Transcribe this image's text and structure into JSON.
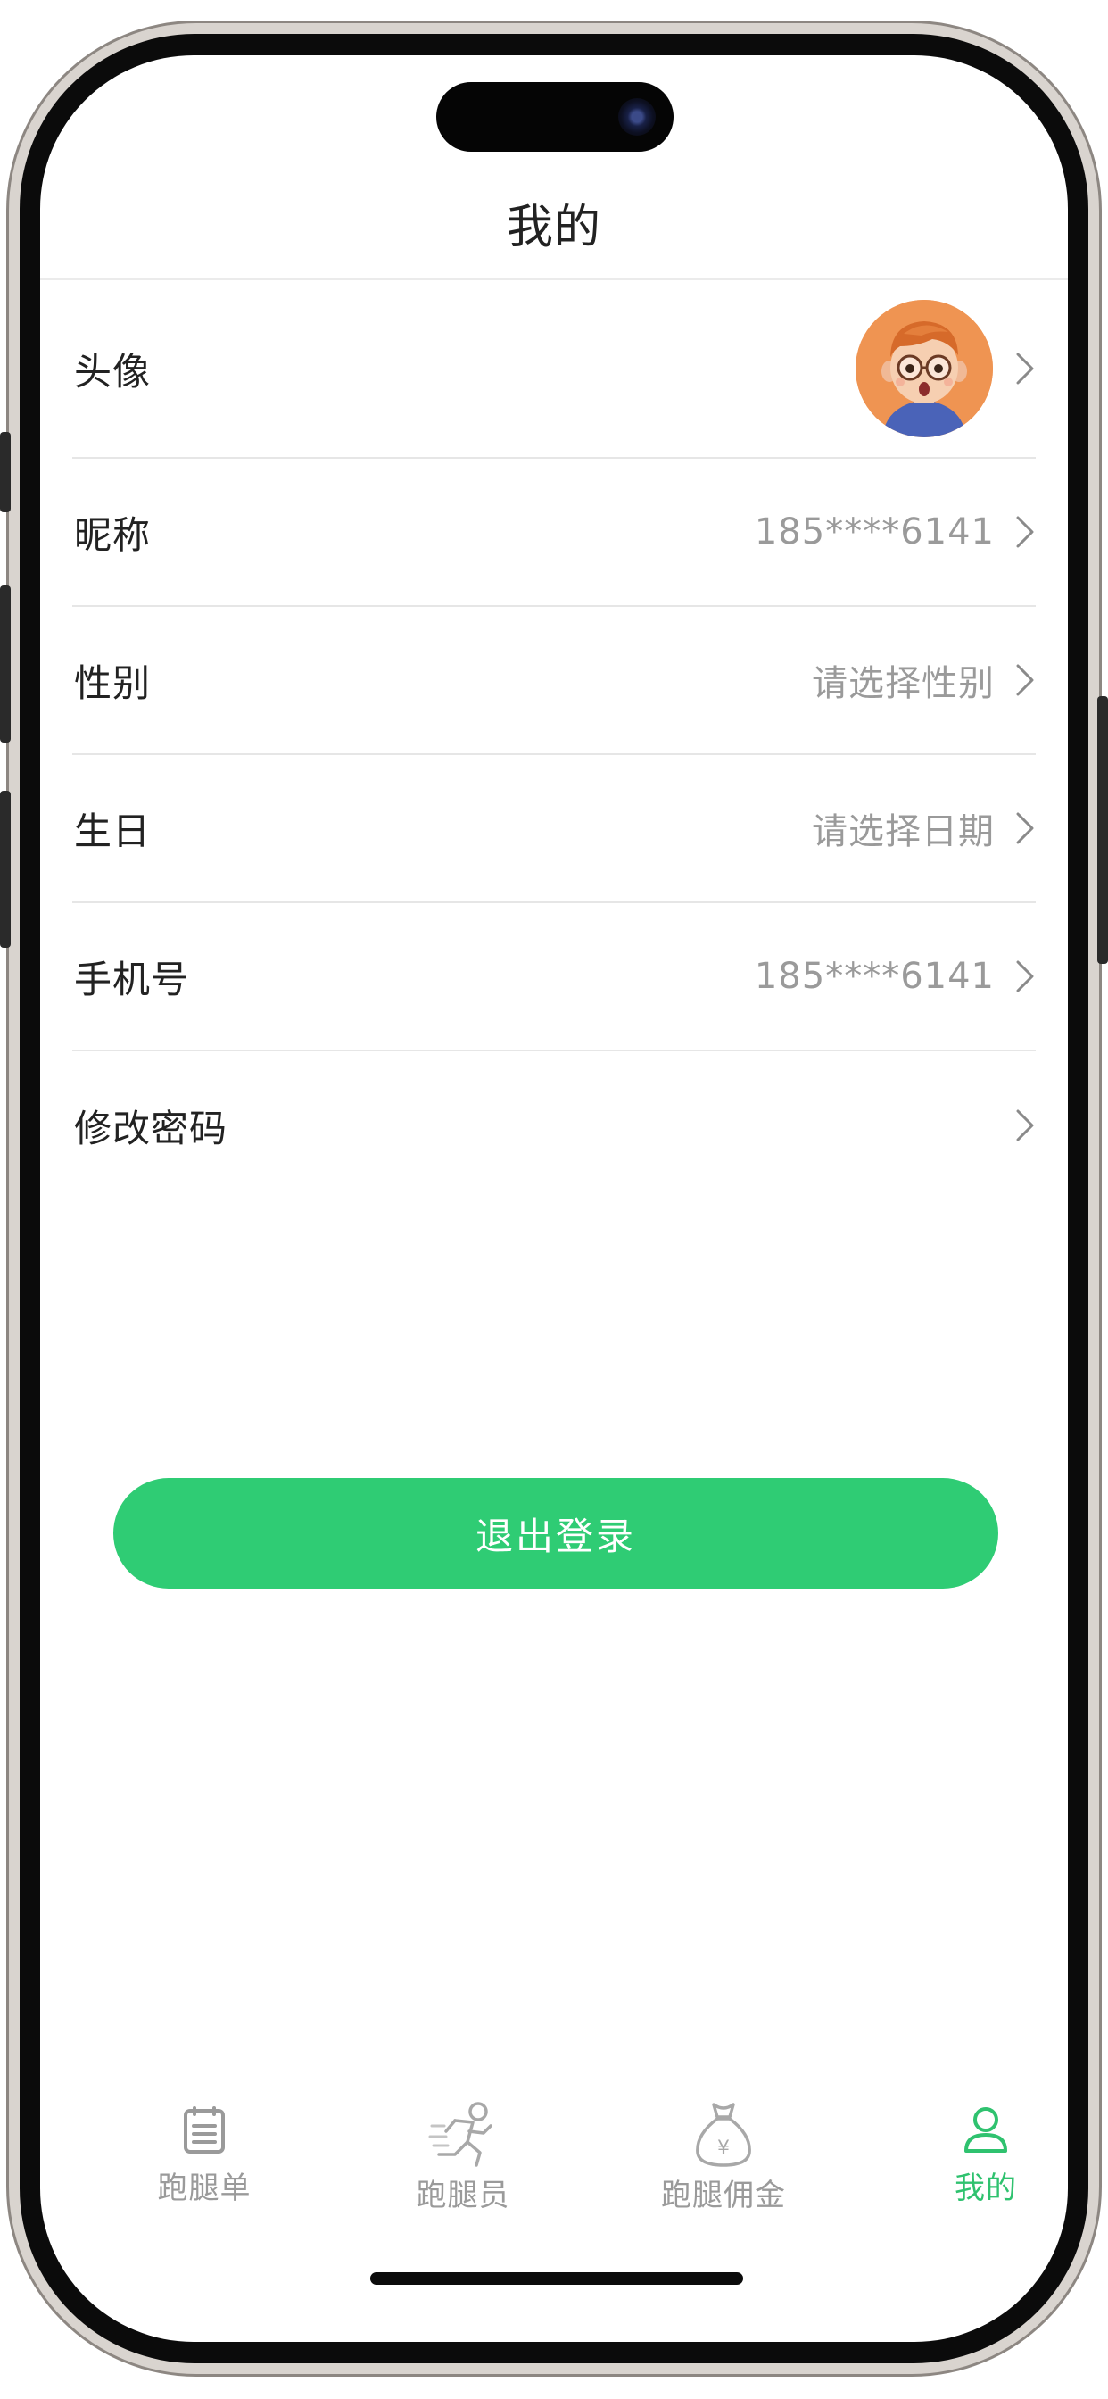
{
  "header": {
    "title": "我的"
  },
  "profile_rows": [
    {
      "label": "头像",
      "value": "",
      "type": "avatar",
      "icon": "chevron-right-icon"
    },
    {
      "label": "昵称",
      "value": "185****6141",
      "icon": "chevron-right-icon"
    },
    {
      "label": "性别",
      "value": "请选择性别",
      "icon": "chevron-right-icon"
    },
    {
      "label": "生日",
      "value": "请选择日期",
      "icon": "chevron-right-icon"
    },
    {
      "label": "手机号",
      "value": "185****6141",
      "icon": "chevron-right-icon"
    },
    {
      "label": "修改密码",
      "value": "",
      "icon": "chevron-right-icon"
    }
  ],
  "logout_button": {
    "label": "退出登录",
    "color": "#2fcc74"
  },
  "tabbar": {
    "active_color": "#2fc26f",
    "inactive_color": "#9a9a9a",
    "tabs": [
      {
        "label": "跑腿单",
        "icon": "order-list-icon",
        "active": false
      },
      {
        "label": "跑腿员",
        "icon": "runner-icon",
        "active": false
      },
      {
        "label": "跑腿佣金",
        "icon": "money-bag-icon",
        "active": false
      },
      {
        "label": "我的",
        "icon": "person-icon",
        "active": true
      }
    ]
  }
}
